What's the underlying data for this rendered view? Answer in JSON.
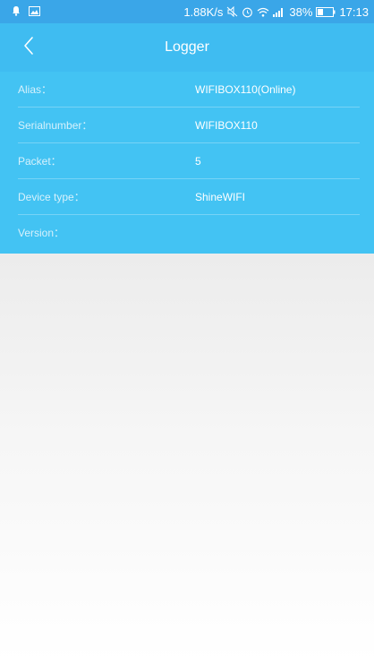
{
  "status_bar": {
    "speed": "1.88K/s",
    "battery_percent": "38%",
    "time": "17:13",
    "icons": [
      "notification-bell-icon",
      "image-icon",
      "mute-icon",
      "alarm-icon",
      "wifi-icon",
      "signal-icon",
      "battery-icon"
    ]
  },
  "header": {
    "title": "Logger",
    "back_icon": "chevron-left-icon"
  },
  "info": {
    "rows": [
      {
        "label": "Alias：",
        "value": "WIFIBOX110(Online)"
      },
      {
        "label": "Serialnumber：",
        "value": "WIFIBOX110"
      },
      {
        "label": "Packet：",
        "value": "5"
      },
      {
        "label": "Device type：",
        "value": "ShineWIFI"
      },
      {
        "label": "Version：",
        "value": ""
      }
    ]
  },
  "colors": {
    "status_bar": "#3aa6e8",
    "title_bar": "#3fbcf1",
    "panel": "#43c3f3",
    "text": "#ffffff"
  }
}
